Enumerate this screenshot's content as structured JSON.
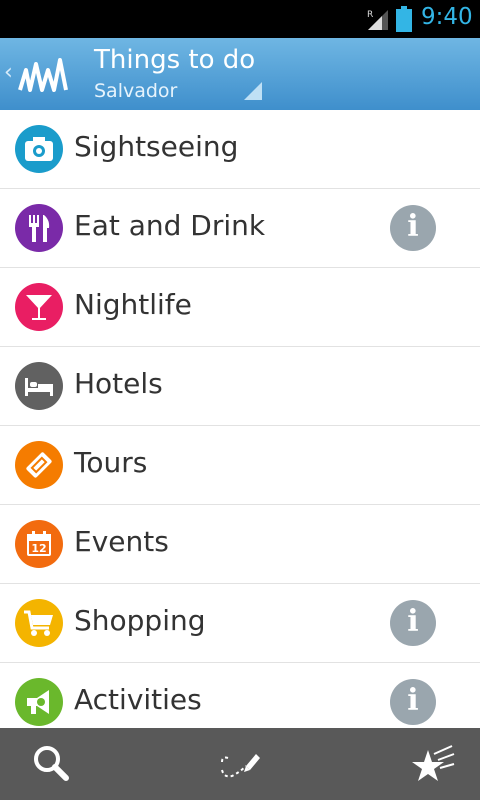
{
  "status_bar": {
    "time": "9:40",
    "network_badge": "R"
  },
  "action_bar": {
    "title": "Things to do",
    "subtitle": "Salvador",
    "back_glyph": "‹"
  },
  "categories": [
    {
      "label": "Sightseeing",
      "icon": "camera-icon",
      "color": "#1a9ccb",
      "info": false
    },
    {
      "label": "Eat and Drink",
      "icon": "fork-knife-icon",
      "color": "#7a2aa8",
      "info": true
    },
    {
      "label": "Nightlife",
      "icon": "cocktail-icon",
      "color": "#e91e63",
      "info": false
    },
    {
      "label": "Hotels",
      "icon": "bed-icon",
      "color": "#616161",
      "info": false
    },
    {
      "label": "Tours",
      "icon": "ticket-icon",
      "color": "#f57c00",
      "info": false
    },
    {
      "label": "Events",
      "icon": "calendar-icon",
      "color": "#f26b0f",
      "info": false,
      "calendar_day": "12"
    },
    {
      "label": "Shopping",
      "icon": "cart-icon",
      "color": "#f4b400",
      "info": true
    },
    {
      "label": "Activities",
      "icon": "megaphone-icon",
      "color": "#6ab82c",
      "info": true
    }
  ],
  "info_glyph": "i",
  "bottom_bar": {
    "icons": [
      "search-icon",
      "route-draw-icon",
      "favorites-icon"
    ]
  }
}
